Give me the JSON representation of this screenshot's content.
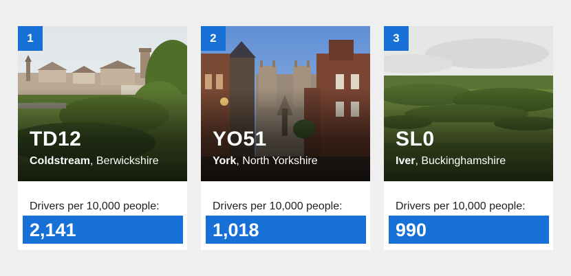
{
  "cards": [
    {
      "rank": "1",
      "postcode": "TD12",
      "town": "Coldstream",
      "region": ", Berwickshire",
      "stat_label": "Drivers per 10,000 people:",
      "value": "2,141",
      "photo_icon": "town-landscape-photo"
    },
    {
      "rank": "2",
      "postcode": "YO51",
      "town": "York",
      "region": ", North Yorkshire",
      "stat_label": "Drivers per 10,000 people:",
      "value": "1,018",
      "photo_icon": "cathedral-street-photo"
    },
    {
      "rank": "3",
      "postcode": "SL0",
      "town": "Iver",
      "region": ", Buckinghamshire",
      "stat_label": "Drivers per 10,000 people:",
      "value": "990",
      "photo_icon": "countryside-photo"
    }
  ],
  "colors": {
    "accent": "#1670d6",
    "background": "#efefef",
    "card": "#ffffff"
  }
}
